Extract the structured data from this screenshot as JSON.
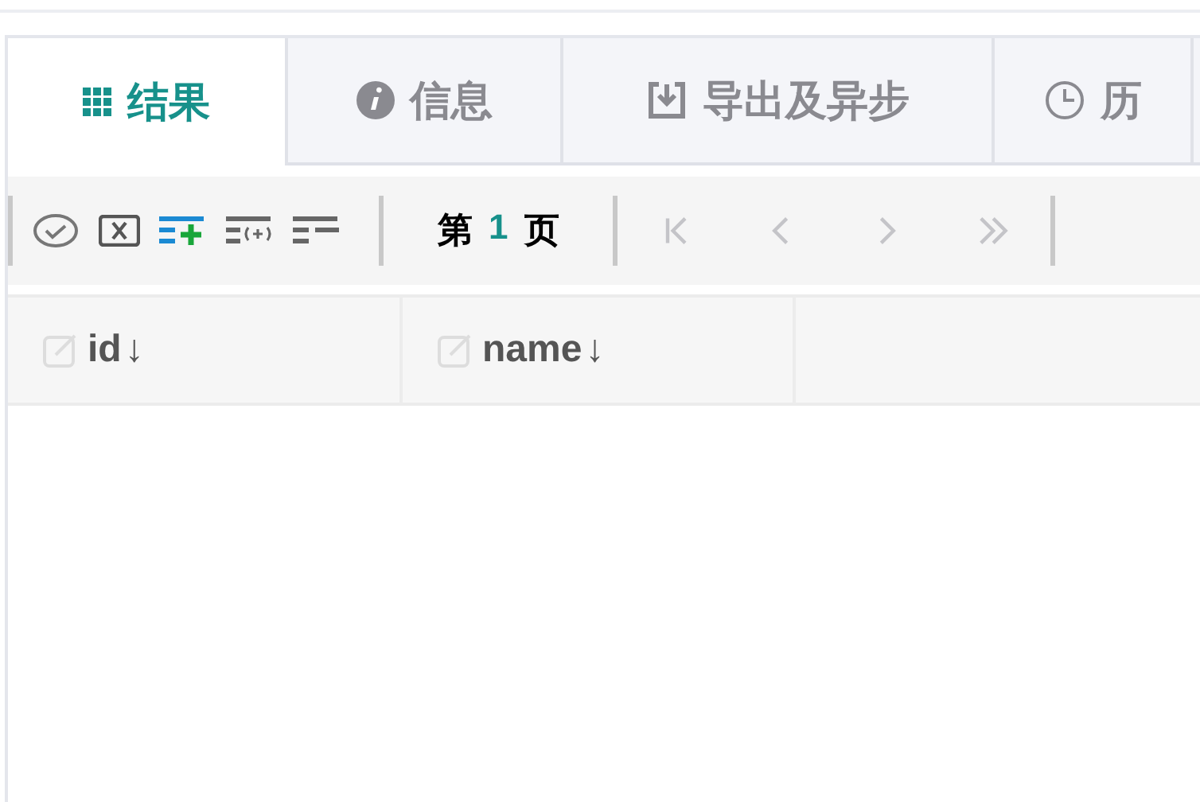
{
  "tabs": [
    {
      "label": "结果",
      "kind": "grid",
      "selected": true
    },
    {
      "label": "信息",
      "kind": "info",
      "selected": false
    },
    {
      "label": "导出及异步",
      "kind": "download",
      "selected": false
    },
    {
      "label": "历",
      "kind": "clock",
      "selected": false
    }
  ],
  "toolbar": {
    "tools": [
      {
        "kind": "check"
      },
      {
        "kind": "cancel"
      },
      {
        "kind": "add-row"
      },
      {
        "kind": "insert-row"
      },
      {
        "kind": "remove-row"
      }
    ],
    "page": {
      "prefix": "第",
      "number": "1",
      "suffix": "页"
    },
    "nav": [
      {
        "kind": "first",
        "disabled": true
      },
      {
        "kind": "prev",
        "disabled": true
      },
      {
        "kind": "next",
        "disabled": true
      },
      {
        "kind": "last",
        "disabled": true
      }
    ]
  },
  "table": {
    "columns": [
      {
        "label": "id",
        "sort": "↓"
      },
      {
        "label": "name",
        "sort": "↓"
      }
    ]
  }
}
